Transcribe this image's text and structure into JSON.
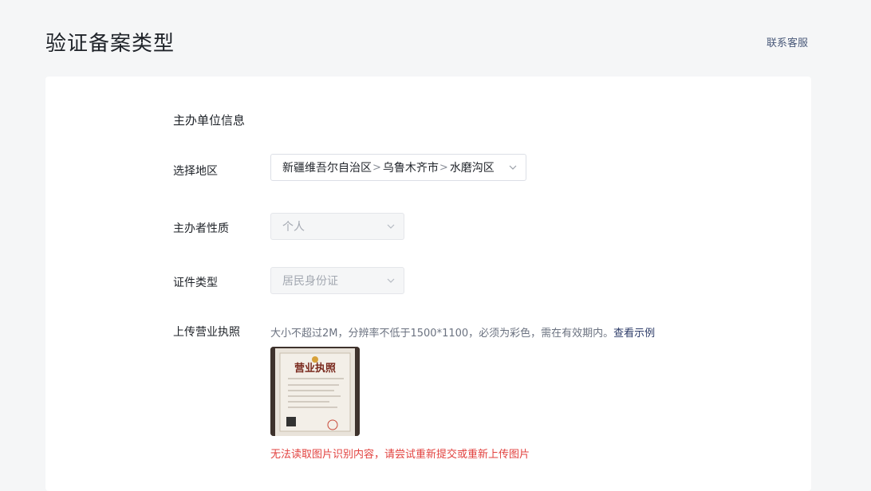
{
  "header": {
    "title": "验证备案类型",
    "support_link": "联系客服"
  },
  "form": {
    "section_title": "主办单位信息",
    "region": {
      "label": "选择地区",
      "province": "新疆维吾尔自治区",
      "city": "乌鲁木齐市",
      "district": "水磨沟区",
      "separator": ">"
    },
    "nature": {
      "label": "主办者性质",
      "value": "个人"
    },
    "id_type": {
      "label": "证件类型",
      "value": "居民身份证"
    },
    "upload": {
      "label": "上传营业执照",
      "hint": "大小不超过2M，分辨率不低于1500*1100，必须为彩色，需在有效期内。",
      "hint_link": "查看示例",
      "thumbnail_caption": "营业执照",
      "error": "无法读取图片识别内容，请尝试重新提交或重新上传图片"
    }
  },
  "colors": {
    "background": "#f5f6f7",
    "card": "#ffffff",
    "error": "#e2423f",
    "link": "#2b3a67"
  }
}
